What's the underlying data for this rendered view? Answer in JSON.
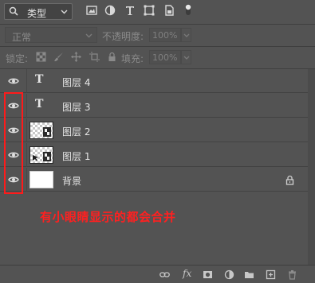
{
  "filter": {
    "kind_label": "类型"
  },
  "blend": {
    "mode": "正常",
    "opacity_label": "不透明度:",
    "opacity_value": "100%"
  },
  "lock": {
    "lock_label": "锁定:",
    "fill_label": "填充:",
    "fill_value": "100%"
  },
  "layers": [
    {
      "name": "图层 4",
      "kind": "text",
      "visible": true
    },
    {
      "name": "图层 3",
      "kind": "text",
      "visible": true
    },
    {
      "name": "图层 2",
      "kind": "image",
      "visible": true
    },
    {
      "name": "图层 1",
      "kind": "image",
      "visible": true
    },
    {
      "name": "背景",
      "kind": "background",
      "visible": true,
      "locked": true
    }
  ],
  "annotation": {
    "text": "有小眼睛显示的都会合并",
    "color": "#ff2020"
  },
  "type_glyph": "T",
  "fx_label": "fx"
}
